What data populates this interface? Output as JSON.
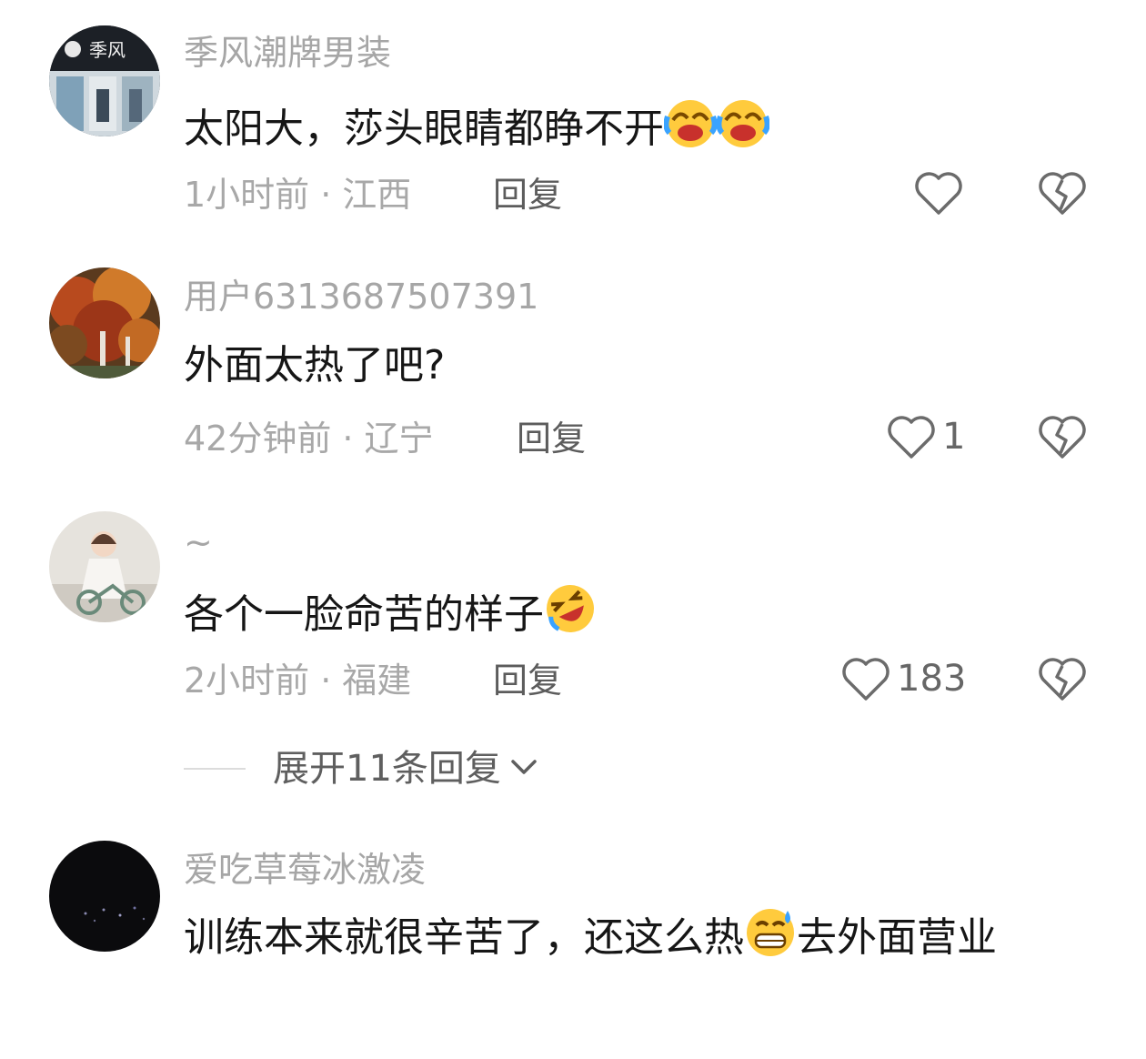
{
  "comments": [
    {
      "username": "季风潮牌男装",
      "avatar_label": "季风",
      "text_main": "太阳大，莎头眼睛都睁不开",
      "emojis": [
        "laughing-crying-emoji",
        "laughing-crying-emoji"
      ],
      "time": "1小时前",
      "location": "江西",
      "reply_label": "回复",
      "like_count": ""
    },
    {
      "username": "用户6313687507391",
      "text_main": "外面太热了吧?",
      "time": "42分钟前",
      "location": "辽宁",
      "reply_label": "回复",
      "like_count": "1"
    },
    {
      "username": "~",
      "text_main": "各个一脸命苦的样子",
      "emojis": [
        "rolling-laughing-emoji"
      ],
      "time": "2小时前",
      "location": "福建",
      "reply_label": "回复",
      "like_count": "183",
      "expand_label": "展开11条回复"
    },
    {
      "username": "爱吃草莓冰激凌",
      "text_before": "训练本来就很辛苦了，还这么热",
      "text_after": "去外面营业",
      "emojis": [
        "grinning-sweat-emoji"
      ]
    }
  ],
  "separator": "·",
  "icons": {
    "like": "heart-outline-icon",
    "dislike": "broken-heart-icon",
    "expand": "chevron-down-icon"
  },
  "colors": {
    "username": "#a6a6a6",
    "content": "#161616",
    "meta": "#a8a8a8",
    "reply": "#5c5c5c"
  }
}
